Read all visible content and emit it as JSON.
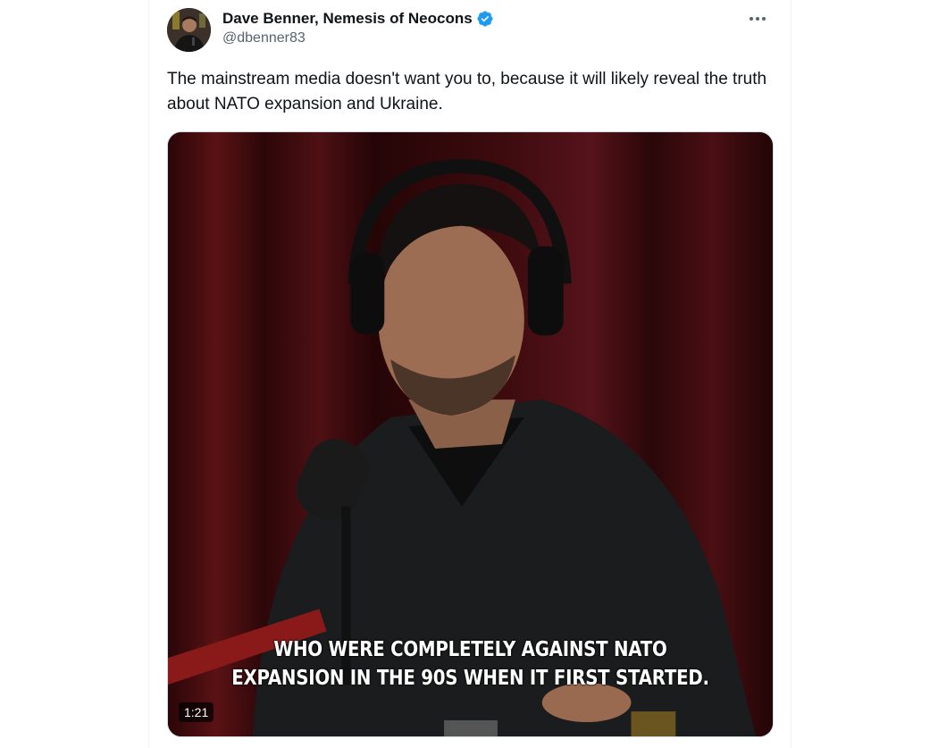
{
  "tweet": {
    "author": {
      "display_name": "Dave Benner, Nemesis of Neocons",
      "handle": "@dbenner83",
      "verified": true,
      "verified_color": "#1d9bf0"
    },
    "text": "The mainstream media doesn't want you to, because it will likely reveal the truth about NATO expansion and Ukraine.",
    "media": {
      "type": "video",
      "caption_line1": "WHO WERE COMPLETELY AGAINST NATO",
      "caption_line2": "EXPANSION IN THE 90S WHEN IT FIRST STARTED.",
      "duration": "1:21"
    }
  },
  "icons": {
    "more": "more-horizontal-icon",
    "verified": "verified-badge-icon"
  }
}
